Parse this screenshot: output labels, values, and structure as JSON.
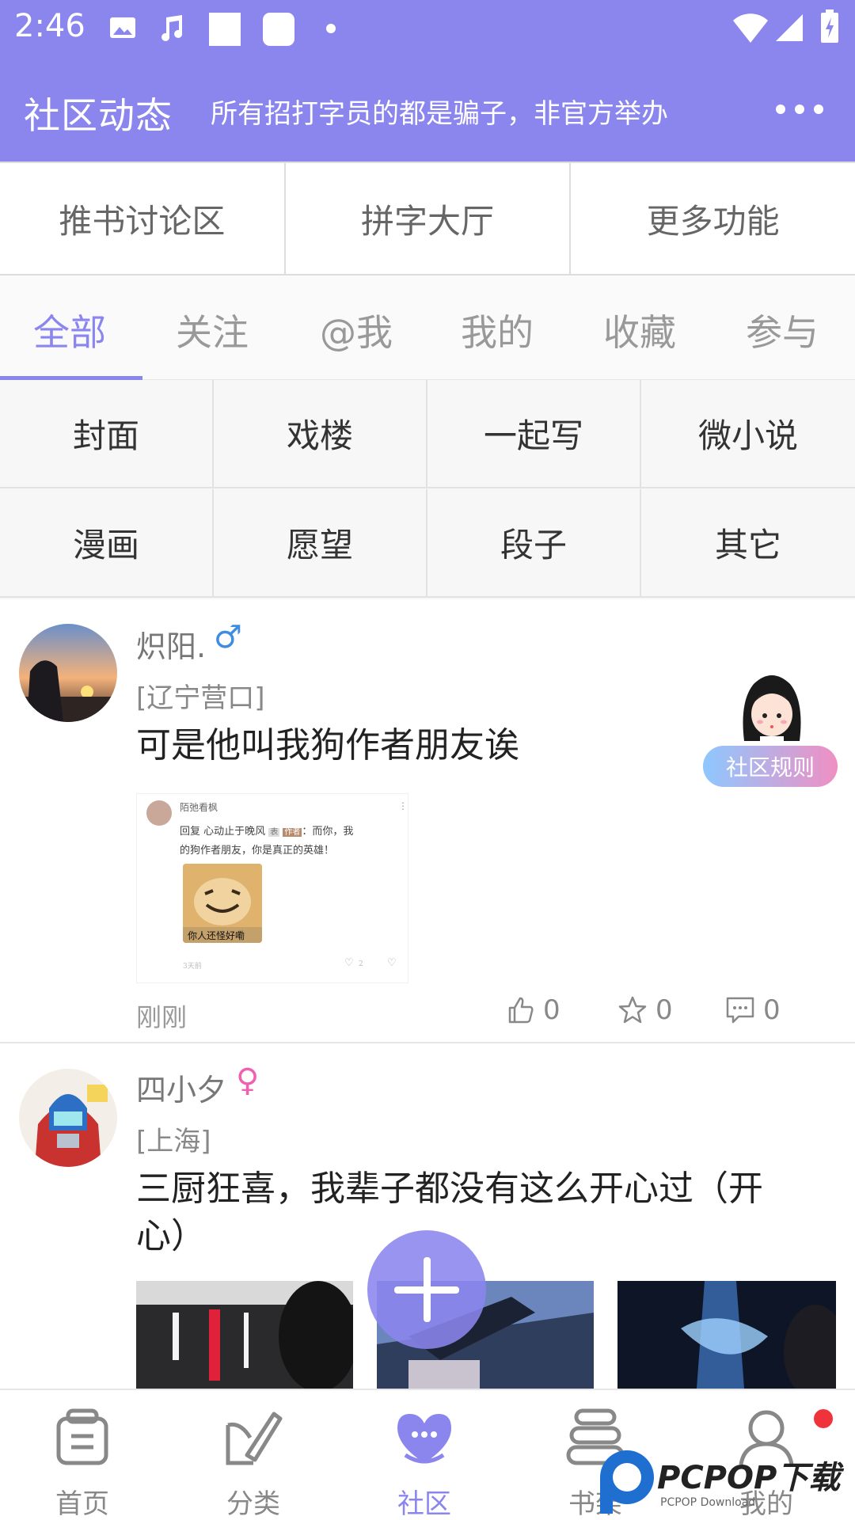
{
  "status_bar": {
    "time": "2:46"
  },
  "header": {
    "title": "社区动态",
    "marquee": "：所有招打字员的都是骗子，非官方举办",
    "more_icon": "more-dots-icon"
  },
  "quick_links": [
    "推书讨论区",
    "拼字大厅",
    "更多功能"
  ],
  "tabs": [
    "全部",
    "关注",
    "@我",
    "我的",
    "收藏",
    "参与"
  ],
  "active_tab": "全部",
  "categories": [
    "封面",
    "戏楼",
    "一起写",
    "微小说",
    "漫画",
    "愿望",
    "段子",
    "其它"
  ],
  "community_rules": "社区规则",
  "posts": [
    {
      "username": "炽阳.",
      "gender_symbol": "♂",
      "location": "[辽宁营口]",
      "content": "可是他叫我狗作者朋友诶",
      "time": "刚刚",
      "likes": "0",
      "stars": "0",
      "comments": "0",
      "screenshot": {
        "author": "陌弛看枫",
        "line1": "回复 心动止于晚风",
        "tag1": "表",
        "tag2": "作者",
        "line1_tail": "：而你，我",
        "line2": "的狗作者朋友，你是真正的英雄！",
        "meme_caption": "你人还怪好嘞",
        "ago": "3天前",
        "like_count": "2"
      }
    },
    {
      "username": "四小夕",
      "gender_symbol": "♀",
      "location": "[上海]",
      "content_line1": "三厨狂喜，我辈子都没有这么开心过（开",
      "content_line2": "心）"
    }
  ],
  "bottom_nav": [
    {
      "label": "首页",
      "icon": "home-icon"
    },
    {
      "label": "分类",
      "icon": "category-icon"
    },
    {
      "label": "社区",
      "icon": "community-icon"
    },
    {
      "label": "书架",
      "icon": "bookshelf-icon"
    },
    {
      "label": "我的",
      "icon": "profile-icon"
    }
  ],
  "active_nav": "社区",
  "watermark": {
    "brand": "PCPOP下载",
    "sub": "PCPOP Download"
  },
  "colors": {
    "accent": "#8b85ee",
    "male": "#3f8de0",
    "female": "#f05fb0",
    "badge": "#f0333a"
  }
}
